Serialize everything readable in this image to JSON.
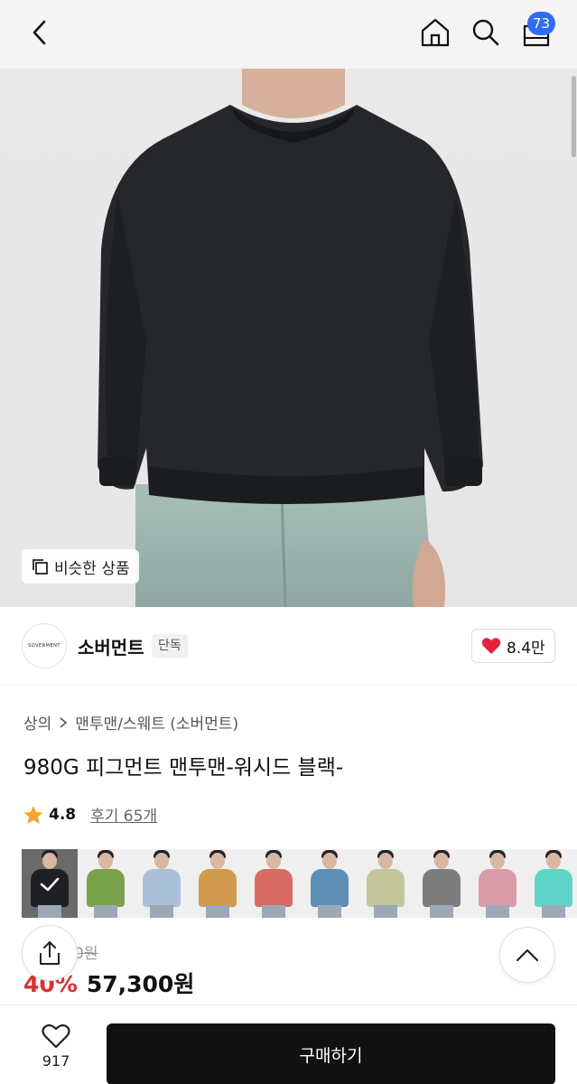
{
  "header": {
    "cart_count": "73"
  },
  "hero": {
    "similar_label": "비슷한 상품"
  },
  "brand": {
    "logo_text": "SOVERMENT",
    "name": "소버먼트",
    "tag": "단독",
    "likes": "8.4만"
  },
  "breadcrumb": {
    "category": "상의",
    "subcategory": "맨투맨/스웨트 (소버먼트)"
  },
  "product": {
    "title": "980G 피그먼트 맨투맨-워시드 블랙-",
    "rating": "4.8",
    "review_label": "후기 65개",
    "original_price_partial": "0원",
    "discount": "40%",
    "price": "57,300원"
  },
  "colors": [
    {
      "name": "black",
      "hex": "#1f2024",
      "selected": true
    },
    {
      "name": "green",
      "hex": "#79a24a"
    },
    {
      "name": "light-blue",
      "hex": "#a9c0d8"
    },
    {
      "name": "mustard",
      "hex": "#d29a4c"
    },
    {
      "name": "coral",
      "hex": "#d96a63"
    },
    {
      "name": "blue",
      "hex": "#5d8fb5"
    },
    {
      "name": "sage",
      "hex": "#c2c69b"
    },
    {
      "name": "gray",
      "hex": "#7d7d7d"
    },
    {
      "name": "pink",
      "hex": "#d99aa8"
    },
    {
      "name": "mint",
      "hex": "#5ed3c8"
    }
  ],
  "bottom_bar": {
    "wish_count": "917",
    "buy_label": "구매하기"
  },
  "accent_colors": {
    "badge_blue": "#2f6cf6",
    "discount_red": "#e22d2d",
    "heart_red": "#e4203a",
    "star_yellow": "#f5a623"
  }
}
